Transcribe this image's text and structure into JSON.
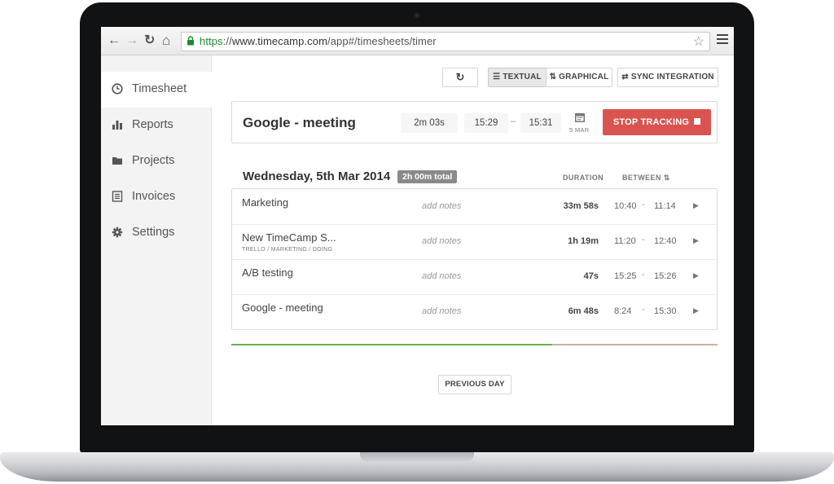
{
  "browser": {
    "url_scheme": "https",
    "url_sep": "://",
    "url_host": "www.timecamp.com",
    "url_path": "/app#/timesheets/timer",
    "back_icon": "←",
    "forward_icon": "→",
    "reload_icon": "↻",
    "home_icon": "⌂",
    "star_icon": "☆"
  },
  "sidebar": {
    "items": [
      {
        "label": "Timesheet",
        "icon": "clock-icon",
        "active": true
      },
      {
        "label": "Reports",
        "icon": "bar-chart-icon"
      },
      {
        "label": "Projects",
        "icon": "folder-icon"
      },
      {
        "label": "Invoices",
        "icon": "invoice-icon"
      },
      {
        "label": "Settings",
        "icon": "gear-icon"
      }
    ]
  },
  "toolbar": {
    "refresh_icon": "↻",
    "textual_label": "TEXTUAL",
    "graphical_label": "GRAPHICAL",
    "sync_label": "SYNC INTEGRATION"
  },
  "tracker": {
    "task": "Google - meeting",
    "elapsed": "2m 03s",
    "start": "15:29",
    "dash": "–",
    "end": "15:31",
    "date_label": "5 MAR",
    "stop_label": "STOP TRACKING"
  },
  "day": {
    "title": "Wednesday, 5th Mar 2014",
    "total": "2h 00m total",
    "col_duration": "DURATION",
    "col_between": "BETWEEN"
  },
  "entries": [
    {
      "name": "Marketing",
      "tags": "",
      "notes": "add notes",
      "duration": "33m 58s",
      "start": "10:40",
      "end": "11:14"
    },
    {
      "name": "New TimeCamp S...",
      "tags": "TRELLO / MARKETING / DOING",
      "notes": "add notes",
      "duration": "1h 19m",
      "start": "11:20",
      "end": "12:40"
    },
    {
      "name": "A/B testing",
      "tags": "",
      "notes": "add notes",
      "duration": "47s",
      "start": "15:25",
      "end": "15:26"
    },
    {
      "name": "Google - meeting",
      "tags": "",
      "notes": "add notes",
      "duration": "6m 48s",
      "start": "8:24",
      "end": "15:30"
    }
  ],
  "entry_sep": "-",
  "day_progress": 0.66,
  "colors": {
    "stop": "#d9534f",
    "progress_green": "#6ab04c",
    "url_green": "#1d8a2b"
  },
  "footer": {
    "prev_label": "PREVIOUS DAY"
  }
}
